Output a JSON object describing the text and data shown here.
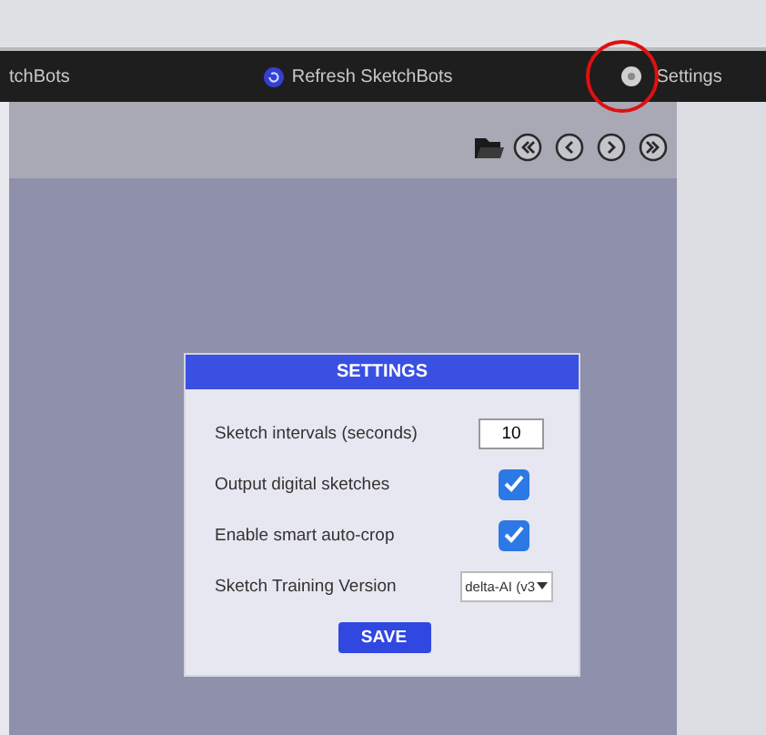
{
  "top_bar": {
    "items": [
      {
        "kind": "link",
        "label": "tchBots"
      },
      {
        "kind": "refresh",
        "label": "Refresh SketchBots"
      },
      {
        "kind": "settings",
        "label": "Settings"
      }
    ]
  },
  "toolbar": {
    "buttons": [
      {
        "kind": "folder"
      },
      {
        "kind": "first"
      },
      {
        "kind": "prev"
      },
      {
        "kind": "next"
      },
      {
        "kind": "last"
      }
    ]
  },
  "settings_dialog": {
    "title": "SETTINGS",
    "fields": [
      {
        "kind": "number",
        "label": "Sketch intervals (seconds)",
        "value": "10"
      },
      {
        "kind": "checkbox",
        "label": "Output digital sketches",
        "checked": true
      },
      {
        "kind": "checkbox",
        "label": "Enable smart auto-crop",
        "checked": true
      },
      {
        "kind": "select",
        "label": "Sketch Training Version",
        "value": "delta-AI (v3"
      }
    ],
    "save_button": "SAVE"
  }
}
